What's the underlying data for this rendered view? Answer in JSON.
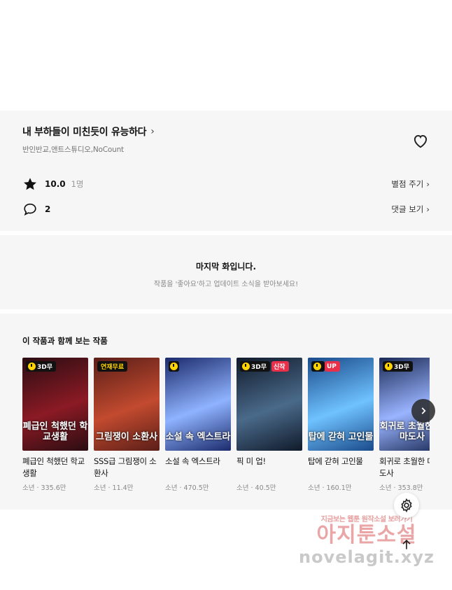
{
  "series": {
    "title": "내 부하들이 미친듯이 유능하다",
    "authors": "반인반교,앤트스튜디오,NoCount",
    "rating": "10.0",
    "rating_count": "1명",
    "rate_link": "별점 주기",
    "comment_count": "2",
    "comment_link": "댓글 보기"
  },
  "last_episode": {
    "title": "마지막 화입니다.",
    "subtitle": "작품을 '좋아요'하고 업데이트 소식을 받아보세요!"
  },
  "recommend": {
    "heading": "이 작품과 함께 보는 작품",
    "items": [
      {
        "badge": "3D무",
        "badge_type": "wait",
        "cover_text": "폐급인 척했던 학교생활",
        "title": "폐급인 척했던 학교생활",
        "meta": "소년 · 335.6만",
        "colors": [
          "#2a0d12",
          "#8b1a24"
        ]
      },
      {
        "badge": "연재무료",
        "badge_type": "free",
        "cover_text": "그림쟁이 소환사",
        "title": "SSS급 그림쟁이 소환사",
        "meta": "소년 · 11.4만",
        "colors": [
          "#5a1e18",
          "#c24a2f"
        ]
      },
      {
        "badge": "",
        "badge_type": "wait-icon",
        "cover_text": "소설 속 엑스트라",
        "title": "소설 속 엑스트라",
        "meta": "소년 · 470.5만",
        "colors": [
          "#1b2a6b",
          "#8fb3ff"
        ]
      },
      {
        "badge": "3D무",
        "badge_type": "wait",
        "extra_badge": "신작",
        "cover_text": "",
        "title": "픽 미 업!",
        "meta": "소년 · 40.5만",
        "colors": [
          "#101a2a",
          "#4a6a8a"
        ]
      },
      {
        "badge": "UP",
        "badge_type": "up",
        "cover_text": "탑에 갇혀 고인물",
        "title": "탑에 갇혀 고인물",
        "meta": "소년 · 160.1만",
        "colors": [
          "#1a4a8a",
          "#6fc2ff"
        ]
      },
      {
        "badge": "3D무",
        "badge_type": "wait",
        "cover_text": "회귀로 초월한 대마도사",
        "title": "회귀로 초월한 대마도사",
        "meta": "소년 · 353.8만",
        "colors": [
          "#1a2a55",
          "#9ab4ff"
        ]
      }
    ]
  },
  "watermark": {
    "small": "지금보는 웹툰 원작소설 보러가기",
    "big": "아지툰소설",
    "url": "novelagit.xyz"
  },
  "icons": {
    "heart": "heart-icon",
    "star": "star-icon",
    "comment": "comment-icon",
    "next": "chevron-right-icon",
    "settings": "gear-icon",
    "to_top": "arrow-up-icon"
  }
}
